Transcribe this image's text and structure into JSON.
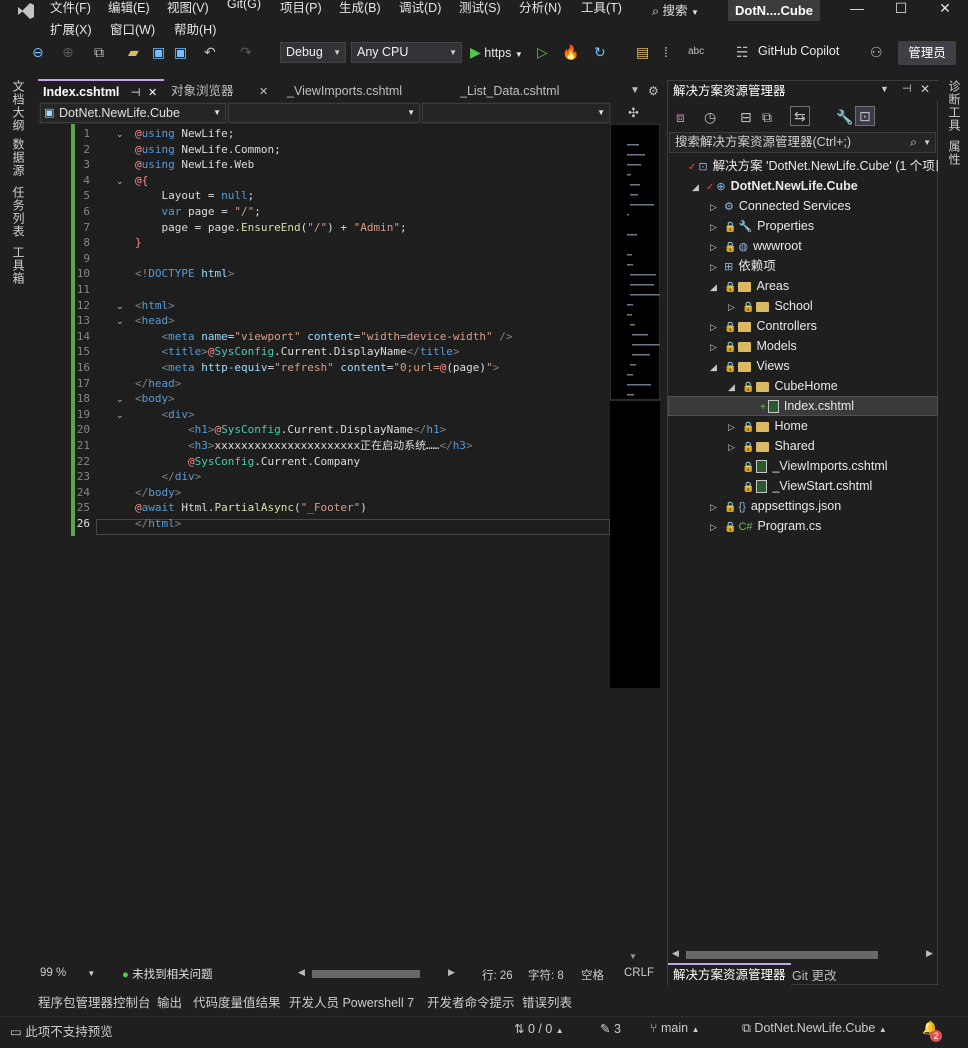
{
  "app": {
    "logo": "VS",
    "title_badge": "DotN....Cube",
    "search": "搜索",
    "window_minimize": "—",
    "window_maximize": "☐",
    "window_close": "✕"
  },
  "menu": [
    "文件(F)",
    "编辑(E)",
    "视图(V)",
    "Git(G)",
    "项目(P)",
    "生成(B)",
    "调试(D)",
    "测试(S)",
    "分析(N)",
    "工具(T)",
    "扩展(X)",
    "窗口(W)",
    "帮助(H)"
  ],
  "toolbar": {
    "config": "Debug",
    "platform": "Any CPU",
    "run_target": "https",
    "copilot": "GitHub Copilot",
    "admin": "管理员"
  },
  "left_strip": [
    "文档大纲",
    "数据源",
    "任务列表",
    "工具箱"
  ],
  "right_strip": [
    "诊断工具",
    "属性"
  ],
  "editor": {
    "tabs": [
      {
        "label": "Index.cshtml",
        "pin": "⊣",
        "close": "✕",
        "active": true
      },
      {
        "label": "对象浏览器",
        "close": "✕"
      },
      {
        "label": "_ViewImports.cshtml"
      },
      {
        "label": "_List_Data.cshtml"
      }
    ],
    "nav_project": "DotNet.NewLife.Cube",
    "lines": [
      {
        "n": "1",
        "fold": "⌄",
        "segs": [
          [
            "@",
            "#ff8c8c"
          ],
          [
            "using",
            "#569cd6"
          ],
          [
            " NewLife;",
            "#dcdcdc"
          ]
        ]
      },
      {
        "n": "2",
        "segs": [
          [
            "@",
            "#ff8c8c"
          ],
          [
            "using",
            "#569cd6"
          ],
          [
            " NewLife.Common;",
            "#dcdcdc"
          ]
        ]
      },
      {
        "n": "3",
        "segs": [
          [
            "@",
            "#ff8c8c"
          ],
          [
            "using",
            "#569cd6"
          ],
          [
            " NewLife.Web",
            "#dcdcdc"
          ]
        ]
      },
      {
        "n": "4",
        "fold": "⌄",
        "segs": [
          [
            "@{",
            "#ff8c8c"
          ]
        ]
      },
      {
        "n": "5",
        "segs": [
          [
            "    Layout = ",
            "#dcdcdc"
          ],
          [
            "null",
            "#569cd6"
          ],
          [
            ";",
            "#dcdcdc"
          ]
        ]
      },
      {
        "n": "6",
        "segs": [
          [
            "    ",
            "#dcdcdc"
          ],
          [
            "var",
            "#569cd6"
          ],
          [
            " page = ",
            "#dcdcdc"
          ],
          [
            "\"/\"",
            "#d69d85"
          ],
          [
            ";",
            "#dcdcdc"
          ]
        ]
      },
      {
        "n": "7",
        "segs": [
          [
            "    page = page.",
            "#dcdcdc"
          ],
          [
            "EnsureEnd",
            "#dcdcaa"
          ],
          [
            "(",
            "#dcdcdc"
          ],
          [
            "\"/\"",
            "#d69d85"
          ],
          [
            ") + ",
            "#dcdcdc"
          ],
          [
            "\"Admin\"",
            "#d69d85"
          ],
          [
            ";",
            "#dcdcdc"
          ]
        ]
      },
      {
        "n": "8",
        "segs": [
          [
            "}",
            "#ff8c8c"
          ]
        ]
      },
      {
        "n": "9",
        "segs": []
      },
      {
        "n": "10",
        "segs": [
          [
            "<!",
            "#808080"
          ],
          [
            "DOCTYPE",
            "#569cd6"
          ],
          [
            " html",
            "#9cdcfe"
          ],
          [
            ">",
            "#808080"
          ]
        ]
      },
      {
        "n": "11",
        "segs": []
      },
      {
        "n": "12",
        "fold": "⌄",
        "segs": [
          [
            "<",
            "#808080"
          ],
          [
            "html",
            "#569cd6"
          ],
          [
            ">",
            "#808080"
          ]
        ]
      },
      {
        "n": "13",
        "fold": "⌄",
        "segs": [
          [
            "<",
            "#808080"
          ],
          [
            "head",
            "#569cd6"
          ],
          [
            ">",
            "#808080"
          ]
        ]
      },
      {
        "n": "14",
        "segs": [
          [
            "    <",
            "#808080"
          ],
          [
            "meta",
            "#569cd6"
          ],
          [
            " name",
            "#9cdcfe"
          ],
          [
            "=",
            "#dcdcdc"
          ],
          [
            "\"viewport\"",
            "#d69d85"
          ],
          [
            " content",
            "#9cdcfe"
          ],
          [
            "=",
            "#dcdcdc"
          ],
          [
            "\"width=device-width\"",
            "#d69d85"
          ],
          [
            " />",
            "#808080"
          ]
        ]
      },
      {
        "n": "15",
        "segs": [
          [
            "    <",
            "#808080"
          ],
          [
            "title",
            "#569cd6"
          ],
          [
            ">",
            "#808080"
          ],
          [
            "@",
            "#ff8c8c"
          ],
          [
            "SysConfig",
            "#4ec9b0"
          ],
          [
            ".Current.DisplayName",
            "#dcdcdc"
          ],
          [
            "</",
            "#808080"
          ],
          [
            "title",
            "#569cd6"
          ],
          [
            ">",
            "#808080"
          ]
        ]
      },
      {
        "n": "16",
        "segs": [
          [
            "    <",
            "#808080"
          ],
          [
            "meta",
            "#569cd6"
          ],
          [
            " http-equiv",
            "#9cdcfe"
          ],
          [
            "=",
            "#dcdcdc"
          ],
          [
            "\"refresh\"",
            "#d69d85"
          ],
          [
            " content",
            "#9cdcfe"
          ],
          [
            "=",
            "#dcdcdc"
          ],
          [
            "\"0;url=",
            "#d69d85"
          ],
          [
            "@",
            "#ff8c8c"
          ],
          [
            "(page)",
            "#dcdcdc"
          ],
          [
            "\"",
            "#d69d85"
          ],
          [
            ">",
            "#808080"
          ]
        ]
      },
      {
        "n": "17",
        "segs": [
          [
            "</",
            "#808080"
          ],
          [
            "head",
            "#569cd6"
          ],
          [
            ">",
            "#808080"
          ]
        ]
      },
      {
        "n": "18",
        "fold": "⌄",
        "segs": [
          [
            "<",
            "#808080"
          ],
          [
            "body",
            "#569cd6"
          ],
          [
            ">",
            "#808080"
          ]
        ]
      },
      {
        "n": "19",
        "fold": "⌄",
        "segs": [
          [
            "    <",
            "#808080"
          ],
          [
            "div",
            "#569cd6"
          ],
          [
            ">",
            "#808080"
          ]
        ]
      },
      {
        "n": "20",
        "segs": [
          [
            "        <",
            "#808080"
          ],
          [
            "h1",
            "#569cd6"
          ],
          [
            ">",
            "#808080"
          ],
          [
            "@",
            "#ff8c8c"
          ],
          [
            "SysConfig",
            "#4ec9b0"
          ],
          [
            ".Current.DisplayName",
            "#dcdcdc"
          ],
          [
            "</",
            "#808080"
          ],
          [
            "h1",
            "#569cd6"
          ],
          [
            ">",
            "#808080"
          ]
        ]
      },
      {
        "n": "21",
        "segs": [
          [
            "        <",
            "#808080"
          ],
          [
            "h3",
            "#569cd6"
          ],
          [
            ">",
            "#808080"
          ],
          [
            "xxxxxxxxxxxxxxxxxxxxxx正在启动系统……",
            "#dcdcdc"
          ],
          [
            "</",
            "#808080"
          ],
          [
            "h3",
            "#569cd6"
          ],
          [
            ">",
            "#808080"
          ]
        ]
      },
      {
        "n": "22",
        "segs": [
          [
            "        ",
            "#dcdcdc"
          ],
          [
            "@",
            "#ff8c8c"
          ],
          [
            "SysConfig",
            "#4ec9b0"
          ],
          [
            ".Current.Company",
            "#dcdcdc"
          ]
        ]
      },
      {
        "n": "23",
        "segs": [
          [
            "    </",
            "#808080"
          ],
          [
            "div",
            "#569cd6"
          ],
          [
            ">",
            "#808080"
          ]
        ]
      },
      {
        "n": "24",
        "segs": [
          [
            "</",
            "#808080"
          ],
          [
            "body",
            "#569cd6"
          ],
          [
            ">",
            "#808080"
          ]
        ]
      },
      {
        "n": "25",
        "segs": [
          [
            "@",
            "#ff8c8c"
          ],
          [
            "await",
            "#569cd6"
          ],
          [
            " Html.",
            "#dcdcdc"
          ],
          [
            "PartialAsync",
            "#dcdcaa"
          ],
          [
            "(",
            "#dcdcdc"
          ],
          [
            "\"_Footer\"",
            "#d69d85"
          ],
          [
            ")",
            "#dcdcdc"
          ]
        ]
      },
      {
        "n": "26",
        "segs": [
          [
            "</",
            "#808080"
          ],
          [
            "html",
            "#569cd6"
          ],
          [
            ">",
            "#808080"
          ]
        ]
      }
    ],
    "zoom": "99 %",
    "issues": "未找到相关问题",
    "line_pos": "行: 26",
    "char_pos": "字符: 8",
    "space": "空格",
    "eol": "CRLF"
  },
  "solution_explorer": {
    "title": "解决方案资源管理器",
    "search_placeholder": "搜索解决方案资源管理器(Ctrl+;)",
    "items": [
      {
        "label": "解决方案 'DotNet.NewLife.Cube' (1 个项目",
        "indent": 0,
        "tw": "",
        "icon": "⊡",
        "pre": "✓"
      },
      {
        "label": "DotNet.NewLife.Cube",
        "indent": 1,
        "tw": "◢",
        "icon": "⊕",
        "pre": "✓",
        "bold": true
      },
      {
        "label": "Connected Services",
        "indent": 2,
        "tw": "▷",
        "icon": "⚙"
      },
      {
        "label": "Properties",
        "indent": 2,
        "tw": "▷",
        "icon": "🔧",
        "lock": true
      },
      {
        "label": "wwwroot",
        "indent": 2,
        "tw": "▷",
        "icon": "◍",
        "lock": true
      },
      {
        "label": "依赖项",
        "indent": 2,
        "tw": "▷",
        "icon": "⊞"
      },
      {
        "label": "Areas",
        "indent": 2,
        "tw": "◢",
        "icon": "folder",
        "lock": true
      },
      {
        "label": "School",
        "indent": 3,
        "tw": "▷",
        "icon": "folder",
        "lock": true
      },
      {
        "label": "Controllers",
        "indent": 2,
        "tw": "▷",
        "icon": "folder",
        "lock": true
      },
      {
        "label": "Models",
        "indent": 2,
        "tw": "▷",
        "icon": "folder",
        "lock": true
      },
      {
        "label": "Views",
        "indent": 2,
        "tw": "◢",
        "icon": "folder",
        "lock": true
      },
      {
        "label": "CubeHome",
        "indent": 3,
        "tw": "◢",
        "icon": "folder",
        "lock": true
      },
      {
        "label": "Index.cshtml",
        "indent": 4,
        "tw": "",
        "icon": "file",
        "pre": "+",
        "selected": true
      },
      {
        "label": "Home",
        "indent": 3,
        "tw": "▷",
        "icon": "folder",
        "lock": true
      },
      {
        "label": "Shared",
        "indent": 3,
        "tw": "▷",
        "icon": "folder",
        "lock": true
      },
      {
        "label": "_ViewImports.cshtml",
        "indent": 3,
        "tw": "",
        "icon": "file",
        "lock": true
      },
      {
        "label": "_ViewStart.cshtml",
        "indent": 3,
        "tw": "",
        "icon": "file",
        "lock": true
      },
      {
        "label": "appsettings.json",
        "indent": 2,
        "tw": "▷",
        "icon": "{}",
        "lock": true
      },
      {
        "label": "Program.cs",
        "indent": 2,
        "tw": "▷",
        "icon": "C#",
        "lock": true
      }
    ],
    "tabs": [
      "解决方案资源管理器",
      "Git 更改"
    ]
  },
  "bottom_tabs": [
    "程序包管理器控制台",
    "输出",
    "代码度量值结果",
    "开发人员 Powershell 7",
    "开发者命令提示",
    "错误列表"
  ],
  "status": {
    "preview": "此项不支持预览",
    "git_sync": "0 / 0",
    "pencil_count": "3",
    "branch": "main",
    "repo": "DotNet.NewLife.Cube",
    "notifications": "2"
  },
  "colors": {
    "accent": "#c7a6e8",
    "green_bar": "#57a64a",
    "keyword": "#569cd6",
    "string": "#d69d85"
  }
}
